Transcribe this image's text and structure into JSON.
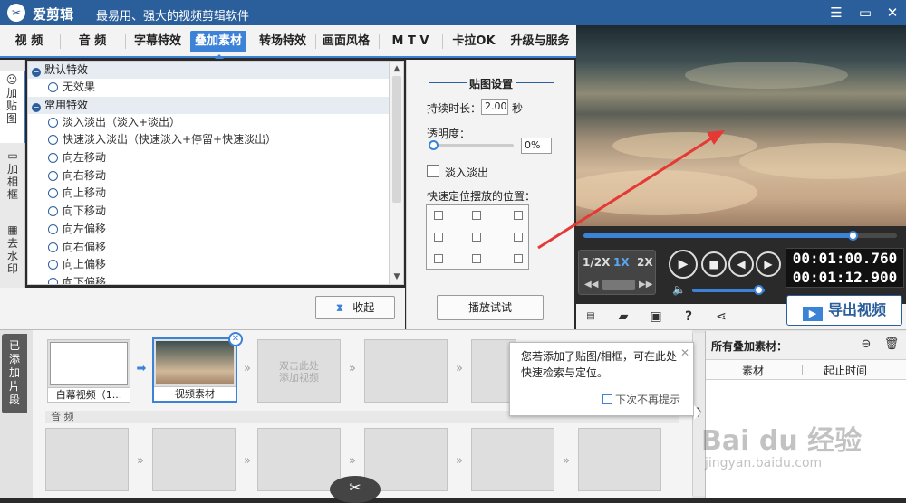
{
  "app": {
    "title": "爱剪辑",
    "subtitle": "最易用、强大的视频剪辑软件"
  },
  "window_controls": {
    "menu": "☰",
    "restore": "▭",
    "close": "✕"
  },
  "tabs": [
    {
      "label": "视 频"
    },
    {
      "label": "音 频"
    },
    {
      "label": "字幕特效"
    },
    {
      "label": "叠加素材",
      "active": true
    },
    {
      "label": "转场特效"
    },
    {
      "label": "画面风格"
    },
    {
      "label": "M T V"
    },
    {
      "label": "卡拉OK"
    },
    {
      "label": "升级与服务"
    }
  ],
  "side_tabs": [
    {
      "label": "加\n贴\n图",
      "icon": "sticker-icon",
      "active": true
    },
    {
      "label": "加\n相\n框",
      "icon": "frame-icon"
    },
    {
      "label": "去\n水\n印",
      "icon": "watermark-icon"
    }
  ],
  "effects": {
    "groups": [
      {
        "name": "默认特效",
        "items": [
          "无效果"
        ]
      },
      {
        "name": "常用特效",
        "items": [
          "淡入淡出（淡入+淡出）",
          "快速淡入淡出（快速淡入+停留+快速淡出）",
          "向左移动",
          "向右移动",
          "向上移动",
          "向下移动",
          "向左偏移",
          "向右偏移",
          "向上偏移",
          "向下偏移"
        ]
      }
    ]
  },
  "buttons": {
    "collapse": "收起",
    "preview_test": "播放试试"
  },
  "sticker_settings": {
    "title": "贴图设置",
    "duration_label": "持续时长：",
    "duration_value": "2.00",
    "duration_unit": "秒",
    "opacity_label": "透明度：",
    "opacity_value": "0%",
    "opacity_level": 0,
    "fade_label": "淡入淡出",
    "fade_checked": false,
    "position_label": "快速定位摆放的位置："
  },
  "player": {
    "progress_fraction": 0.86,
    "speeds": [
      "1/2X",
      "1X",
      "2X"
    ],
    "selected_speed": "1X",
    "time_current": "00:01:00.760",
    "time_total": "00:01:12.900",
    "volume_level": 0.92,
    "export_label": "导出视频"
  },
  "timeline": {
    "side_label": "已\n添\n加\n片\n段",
    "clips": [
      {
        "caption": "白幕视频（1..."
      },
      {
        "caption": "视频素材"
      }
    ],
    "empty_hint": "双击此处\n添加视频",
    "audio_label": "音 频"
  },
  "tooltip": {
    "text": "您若添加了贴图/相框，可在此处快速检索与定位。",
    "no_remind": "下次不再提示"
  },
  "overlay_panel": {
    "title": "所有叠加素材：",
    "col_material": "素材",
    "col_time": "起止时间"
  },
  "watermark": {
    "brand": "Bai du 经验",
    "url": "jingyan.baidu.com"
  },
  "colors": {
    "accent": "#3c82d7",
    "titlebar": "#2b5f9c",
    "annotation_arrow": "#e53935"
  }
}
